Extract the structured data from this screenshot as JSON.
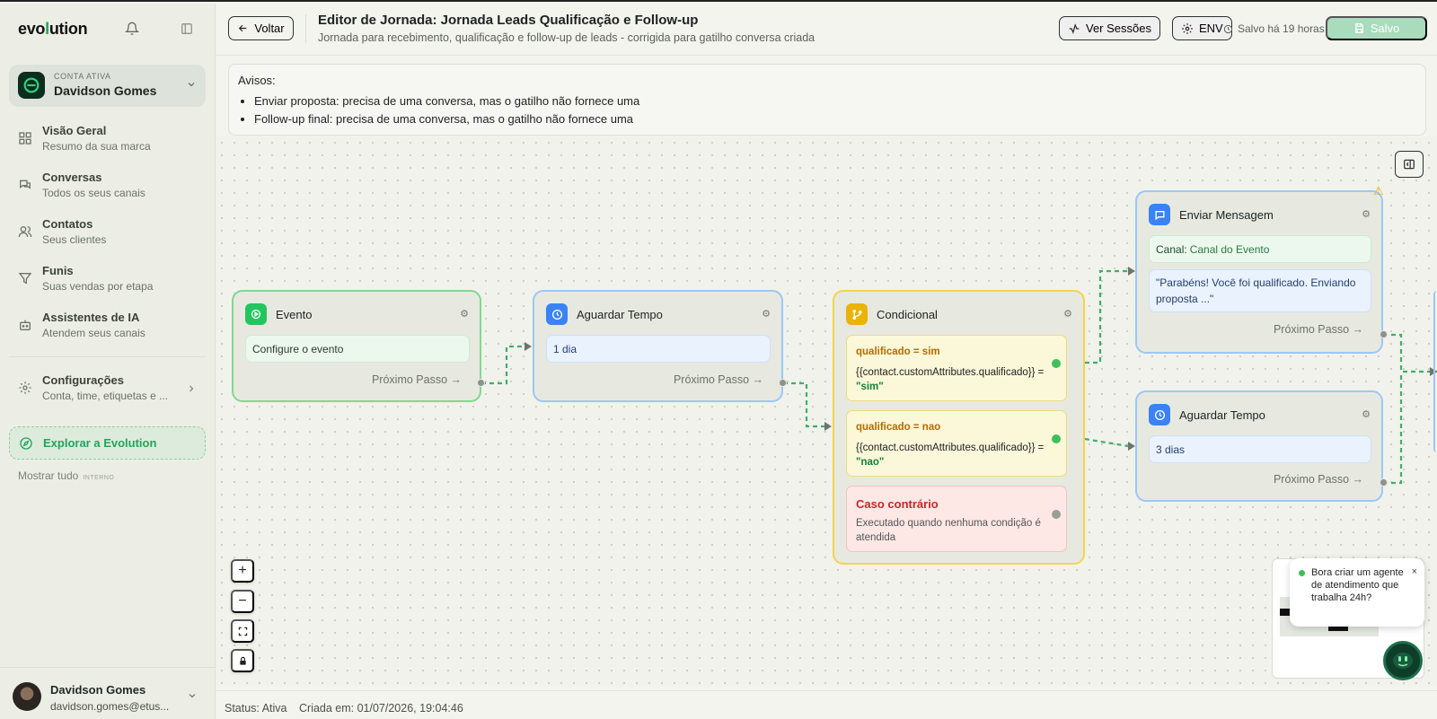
{
  "sidebar": {
    "logo_pre": "evo",
    "logo_mid": "l",
    "logo_post": "ution",
    "account": {
      "kicker": "CONTA ATIVA",
      "name": "Davidson Gomes"
    },
    "items": [
      {
        "title": "Visão Geral",
        "subtitle": "Resumo da sua marca",
        "icon": "grid-icon"
      },
      {
        "title": "Conversas",
        "subtitle": "Todos os seus canais",
        "icon": "chat-icon"
      },
      {
        "title": "Contatos",
        "subtitle": "Seus clientes",
        "icon": "users-icon"
      },
      {
        "title": "Funis",
        "subtitle": "Suas vendas por etapa",
        "icon": "filter-icon"
      },
      {
        "title": "Assistentes de IA",
        "subtitle": "Atendem seus canais",
        "icon": "bot-icon"
      }
    ],
    "settings": {
      "title": "Configurações",
      "subtitle": "Conta, time, etiquetas e ..."
    },
    "explore": "Explorar a Evolution",
    "show_all": "Mostrar tudo",
    "show_all_tag": "INTERNO",
    "user": {
      "name": "Davidson Gomes",
      "email": "davidson.gomes@etus..."
    }
  },
  "header": {
    "back": "Voltar",
    "title": "Editor de Jornada: Jornada Leads Qualificação e Follow-up",
    "subtitle": "Jornada para recebimento, qualificação e follow-up de leads - corrigida para gatilho conversa criada",
    "sessions": "Ver Sessões",
    "env": "ENV",
    "saved_text": "Salvo há 19 horas",
    "save_button": "Salvo"
  },
  "warnings": {
    "title": "Avisos:",
    "items": [
      "Enviar proposta: precisa de uma conversa, mas o gatilho não fornece uma",
      "Follow-up final: precisa de uma conversa, mas o gatilho não fornece uma"
    ]
  },
  "nodes": {
    "evento": {
      "title": "Evento",
      "body": "Configure o evento",
      "next": "Próximo Passo →"
    },
    "aguardar1": {
      "title": "Aguardar Tempo",
      "body": "1 dia",
      "next": "Próximo Passo →"
    },
    "condicional": {
      "title": "Condicional",
      "branches": [
        {
          "label": "qualificado = sim",
          "expr": "{{contact.customAttributes.qualificado}} = ",
          "value": "\"sim\""
        },
        {
          "label": "qualificado = nao",
          "expr": "{{contact.customAttributes.qualificado}} = ",
          "value": "\"nao\""
        }
      ],
      "else_title": "Caso contrário",
      "else_desc": "Executado quando nenhuma condição é atendida"
    },
    "mensagem": {
      "title": "Enviar Mensagem",
      "channel_label": "Canal:",
      "channel_value": "Canal do Evento",
      "message": "\"Parabéns! Você foi qualificado. Enviando proposta ...\"",
      "next": "Próximo Passo →"
    },
    "aguardar2": {
      "title": "Aguardar Tempo",
      "body": "3 dias",
      "next": "Próximo Passo →"
    }
  },
  "tooltip": "Bora criar um agente de atendimento que trabalha 24h?",
  "status": {
    "status": "Status: Ativa",
    "created": "Criada em: 01/07/2026, 19:04:46"
  },
  "colors": {
    "brand": "#22a55a",
    "event": "#22c55e",
    "wait": "#3b82f6",
    "condition": "#eab308",
    "else": "#dc2626"
  }
}
